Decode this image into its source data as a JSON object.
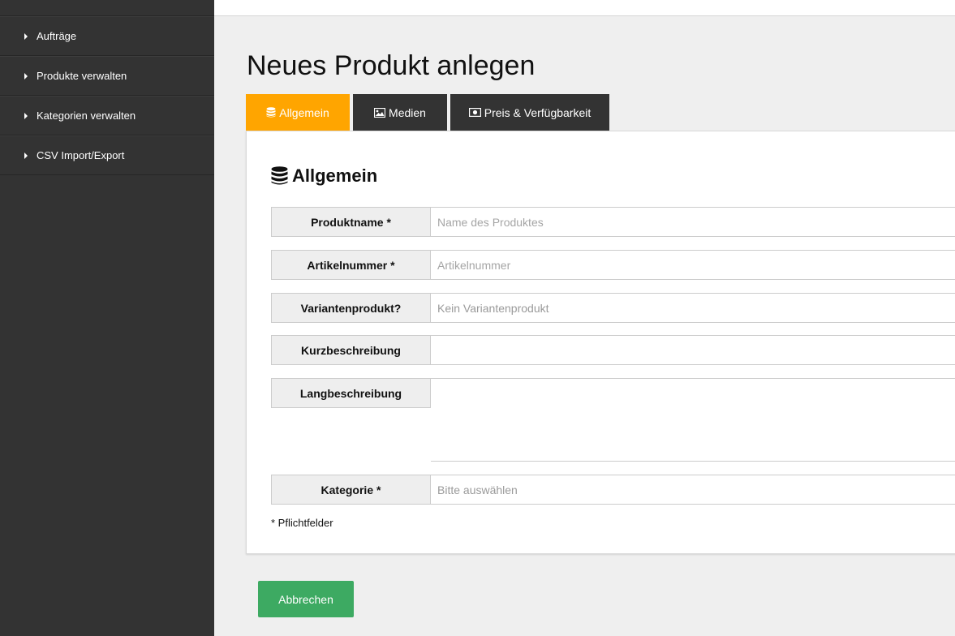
{
  "sidebar": {
    "items": [
      {
        "label": "Aufträge"
      },
      {
        "label": "Produkte verwalten"
      },
      {
        "label": "Kategorien verwalten"
      },
      {
        "label": "CSV Import/Export"
      }
    ]
  },
  "page": {
    "title": "Neues Produkt anlegen"
  },
  "tabs": [
    {
      "label": "Allgemein",
      "icon": "database-icon",
      "active": true
    },
    {
      "label": "Medien",
      "icon": "image-icon",
      "active": false
    },
    {
      "label": "Preis & Verfügbarkeit",
      "icon": "money-icon",
      "active": false
    }
  ],
  "section": {
    "title": "Allgemein",
    "icon": "database-icon"
  },
  "form": {
    "fields": [
      {
        "label": "Produktname *",
        "placeholder": "Name des Produktes",
        "value": ""
      },
      {
        "label": "Artikelnummer *",
        "placeholder": "Artikelnummer",
        "value": ""
      },
      {
        "label": "Variantenprodukt?",
        "placeholder": "Kein Variantenprodukt",
        "value": ""
      },
      {
        "label": "Kurzbeschreibung",
        "placeholder": "",
        "value": ""
      },
      {
        "label": "Langbeschreibung",
        "placeholder": "",
        "value": ""
      },
      {
        "label": "Kategorie *",
        "placeholder": "Bitte auswählen",
        "value": ""
      }
    ],
    "required_note": "* Pflichtfelder"
  },
  "actions": {
    "cancel_label": "Abbrechen"
  },
  "colors": {
    "sidebar_bg": "#333333",
    "tab_active": "#ffa500",
    "tab_inactive": "#333333",
    "cancel_button": "#3daa62"
  }
}
